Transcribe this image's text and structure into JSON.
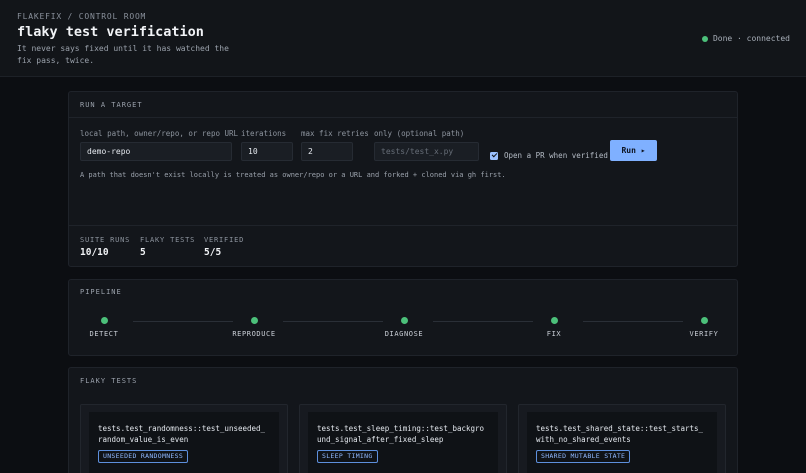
{
  "header": {
    "breadcrumb": "FLAKEFIX / CONTROL ROOM",
    "title": "flaky test verification",
    "subtitle": "It never says fixed until it has watched the fix pass, twice.",
    "status": "Done · connected",
    "status_color": "#4cc07a"
  },
  "run": {
    "title": "RUN A TARGET",
    "target_label": "local path, owner/repo, or repo URL",
    "target_value": "demo-repo",
    "iterations_label": "iterations",
    "iterations_value": "10",
    "retries_label": "max fix retries",
    "retries_value": "2",
    "only_label": "only (optional path)",
    "only_placeholder": "tests/test_x.py",
    "open_pr_label": "Open a PR when verified",
    "run_label": "Run ▸",
    "hint": "A path that doesn't exist locally is treated as owner/repo or a URL and forked + cloned via gh first.",
    "stats": [
      {
        "label": "SUITE RUNS",
        "value": "10/10"
      },
      {
        "label": "FLAKY TESTS",
        "value": "5"
      },
      {
        "label": "VERIFIED",
        "value": "5/5"
      }
    ]
  },
  "pipeline": {
    "title": "PIPELINE",
    "stages": [
      "DETECT",
      "REPRODUCE",
      "DIAGNOSE",
      "FIX",
      "VERIFY"
    ],
    "stage_color": "#4cc07a"
  },
  "flaky": {
    "title": "FLAKY TESTS",
    "tests": [
      {
        "name": "tests.test_randomness::test_unseeded_random_value_is_even",
        "badge": "UNSEEDED RANDOMNESS"
      },
      {
        "name": "tests.test_sleep_timing::test_background_signal_after_fixed_sleep",
        "badge": "SLEEP TIMING"
      },
      {
        "name": "tests.test_shared_state::test_starts_with_no_shared_events",
        "badge": "SHARED MUTABLE STATE"
      }
    ]
  }
}
